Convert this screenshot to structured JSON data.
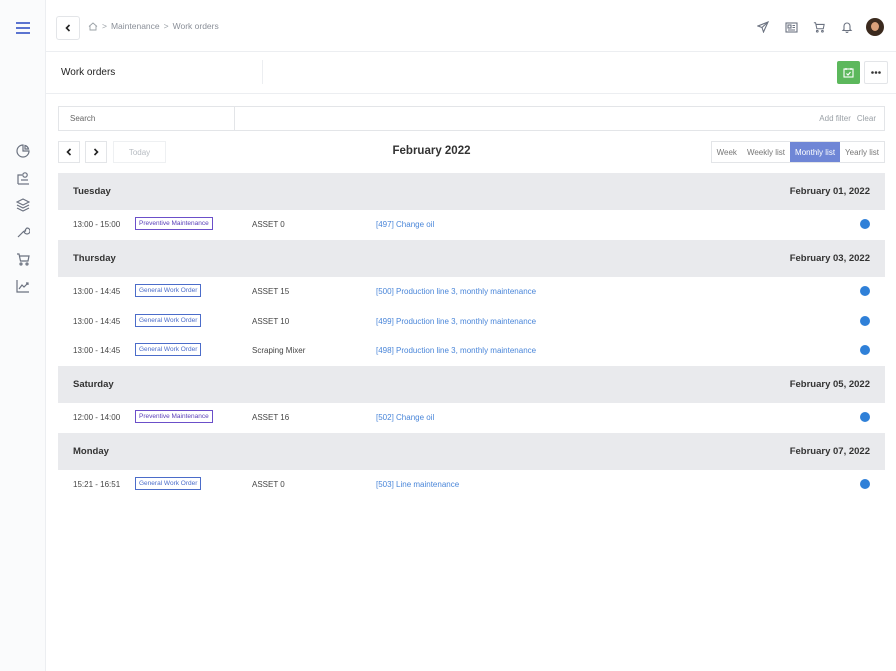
{
  "breadcrumb": {
    "items": [
      "Maintenance",
      "Work orders"
    ],
    "separator": ">"
  },
  "page": {
    "title": "Work orders"
  },
  "search": {
    "placeholder": "Search",
    "add_filter": "Add filter",
    "clear": "Clear"
  },
  "calendar_nav": {
    "today_label": "Today",
    "month_label": "February 2022",
    "views": [
      {
        "label": "Week",
        "active": false
      },
      {
        "label": "Weekly list",
        "active": false
      },
      {
        "label": "Monthly list",
        "active": true
      },
      {
        "label": "Yearly list",
        "active": false
      }
    ]
  },
  "colors": {
    "accent": "#6f86d6",
    "green_button": "#5cb85c",
    "link": "#4a86d9",
    "status_dot": "#2f80d8",
    "day_header_bg": "#e9eaed"
  },
  "days": [
    {
      "name": "Tuesday",
      "date": "February 01, 2022",
      "rows": [
        {
          "time": "13:00 - 15:00",
          "type": "Preventive Maintenance",
          "asset": "ASSET 0",
          "title": "[497] Change oil"
        }
      ]
    },
    {
      "name": "Thursday",
      "date": "February 03, 2022",
      "rows": [
        {
          "time": "13:00 - 14:45",
          "type": "General Work Order",
          "asset": "ASSET 15",
          "title": "[500] Production line 3, monthly maintenance"
        },
        {
          "time": "13:00 - 14:45",
          "type": "General Work Order",
          "asset": "ASSET 10",
          "title": "[499] Production line 3, monthly maintenance"
        },
        {
          "time": "13:00 - 14:45",
          "type": "General Work Order",
          "asset": "Scraping Mixer",
          "title": "[498] Production line 3, monthly maintenance"
        }
      ]
    },
    {
      "name": "Saturday",
      "date": "February 05, 2022",
      "rows": [
        {
          "time": "12:00 - 14:00",
          "type": "Preventive Maintenance",
          "asset": "ASSET 16",
          "title": "[502] Change oil"
        }
      ]
    },
    {
      "name": "Monday",
      "date": "February 07, 2022",
      "rows": [
        {
          "time": "15:21 - 16:51",
          "type": "General Work Order",
          "asset": "ASSET 0",
          "title": "[503] Line maintenance"
        }
      ]
    }
  ],
  "icons": {
    "sidebar": [
      "menu-icon",
      "dashboard-icon",
      "assets-icon",
      "layers-icon",
      "wrench-icon",
      "cart-icon",
      "analytics-icon"
    ],
    "topbar": [
      "send-icon",
      "newspaper-icon",
      "cart-icon",
      "bell-icon",
      "avatar"
    ]
  }
}
